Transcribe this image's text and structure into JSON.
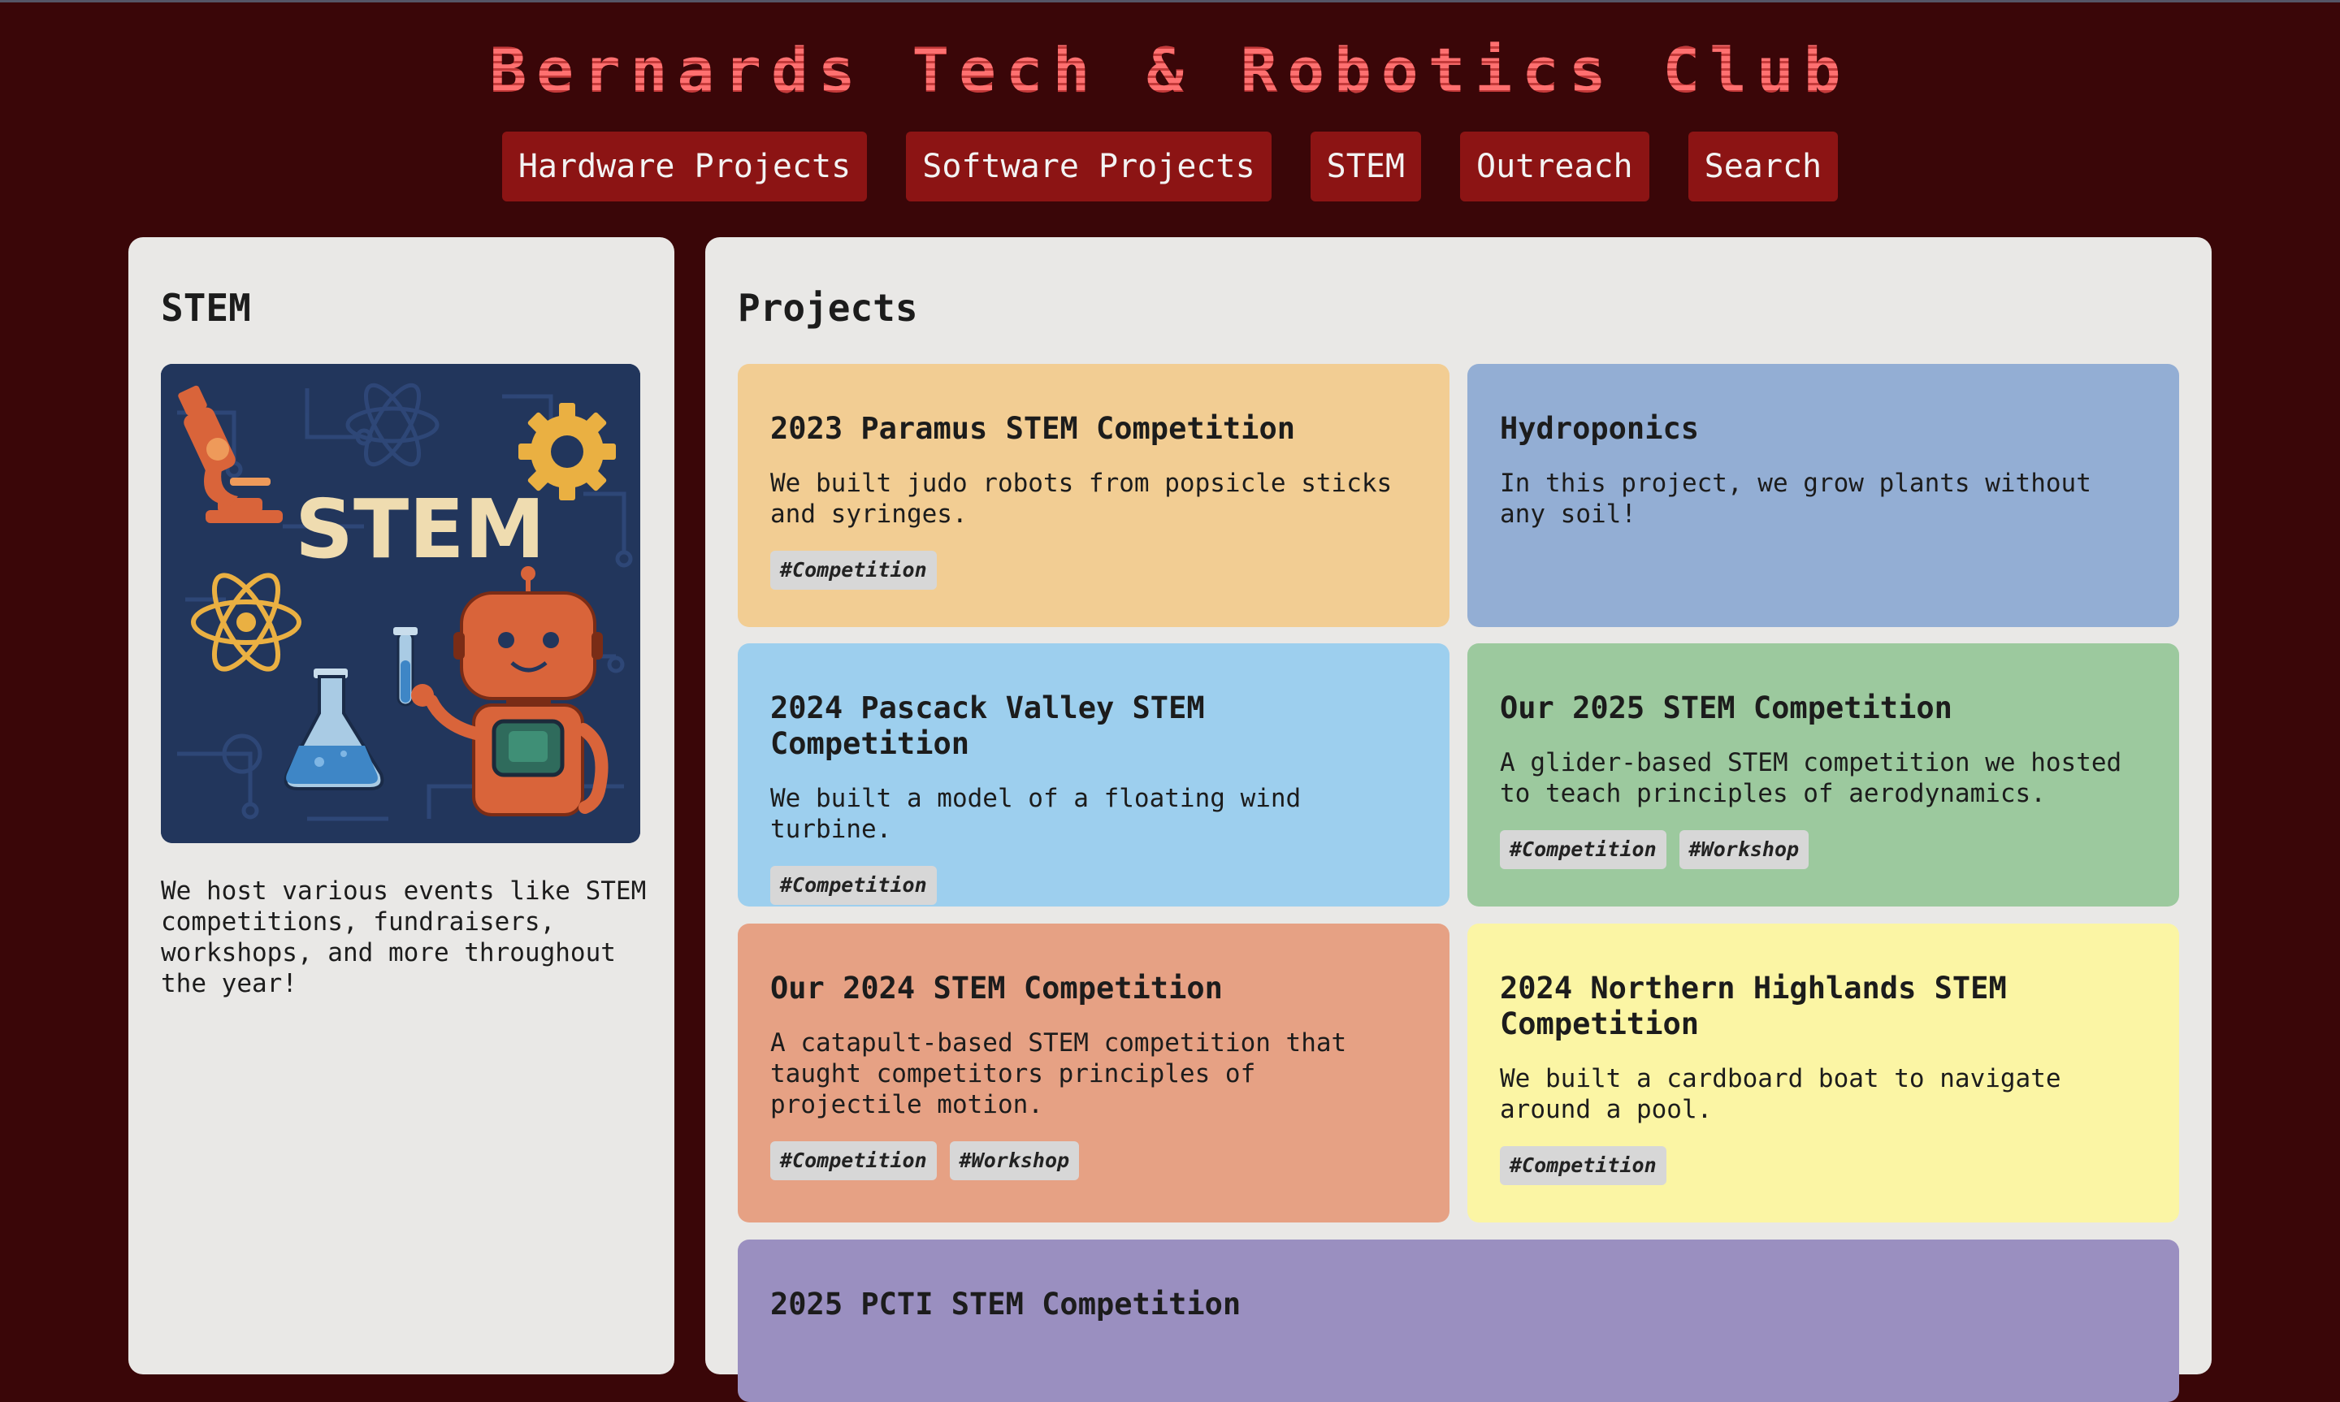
{
  "site": {
    "title": "Bernards Tech & Robotics Club"
  },
  "nav": [
    {
      "label": "Hardware Projects"
    },
    {
      "label": "Software Projects"
    },
    {
      "label": "STEM"
    },
    {
      "label": "Outreach"
    },
    {
      "label": "Search"
    }
  ],
  "sidebar": {
    "heading": "STEM",
    "image_text": "STEM",
    "description": "We host various events like STEM competitions, fundraisers, workshops, and more throughout the year!"
  },
  "main": {
    "heading": "Projects",
    "cards": [
      {
        "title": "2023 Paramus STEM Competition",
        "description": "We built judo robots from popsicle sticks and syringes.",
        "tags": [
          "#Competition"
        ],
        "color": "#f2cd93"
      },
      {
        "title": "Hydroponics",
        "description": "In this project, we grow plants without any soil!",
        "tags": [],
        "color": "#93aed4"
      },
      {
        "title": "2024 Pascack Valley STEM Competition",
        "description": "We built a model of a floating wind turbine.",
        "tags": [
          "#Competition"
        ],
        "color": "#9dcfee"
      },
      {
        "title": "Our 2025 STEM Competition",
        "description": "A glider-based STEM competition we hosted to teach principles of aerodynamics.",
        "tags": [
          "#Competition",
          "#Workshop"
        ],
        "color": "#9cc99e"
      },
      {
        "title": "Our 2024 STEM Competition",
        "description": "A catapult-based STEM competition that taught competitors principles of projectile motion.",
        "tags": [
          "#Competition",
          "#Workshop"
        ],
        "color": "#e6a184"
      },
      {
        "title": "2024 Northern Highlands STEM Competition",
        "description": "We built a cardboard boat to navigate around a pool.",
        "tags": [
          "#Competition"
        ],
        "color": "#fbf5a4"
      },
      {
        "title": "2025 PCTI STEM Competition",
        "description": "",
        "tags": [],
        "color": "#9a8fc0"
      }
    ]
  },
  "colors": {
    "background": "#3a0608",
    "nav_button": "#8c1414",
    "title": "#ff6a6a",
    "panel": "#e9e8e6"
  }
}
